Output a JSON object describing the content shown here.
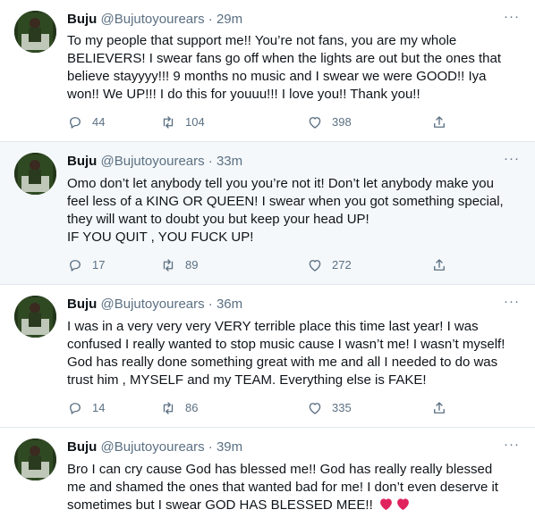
{
  "tweets": [
    {
      "name": "Buju",
      "handle": "@Bujutoyourears",
      "separator": "·",
      "time": "29m",
      "lines": [
        "To my people that support me!! You’re not fans, you are my whole",
        "BELIEVERS! I swear fans go off when the lights are out but the ones that",
        "believe stayyyy!!! 9 months no music and I swear we were GOOD!! Iya",
        "won!! We UP!!! I do this for youuu!!! I love you!! Thank you!!"
      ],
      "replies": "44",
      "retweets": "104",
      "likes": "398"
    },
    {
      "name": "Buju",
      "handle": "@Bujutoyourears",
      "separator": "·",
      "time": "33m",
      "lines": [
        "Omo don’t let anybody tell you you’re not it! Don’t let anybody make you",
        "feel less of a KING OR QUEEN! I swear when you got something special,",
        "they will want to doubt you but keep your head UP!",
        "IF YOU QUIT , YOU FUCK UP!"
      ],
      "replies": "17",
      "retweets": "89",
      "likes": "272"
    },
    {
      "name": "Buju",
      "handle": "@Bujutoyourears",
      "separator": "·",
      "time": "36m",
      "lines": [
        "I was in a very very very VERY terrible place this time last year! I was",
        "confused I really wanted to stop music cause I wasn’t me! I wasn’t myself!",
        "God has really done something great with me and all I needed to do was",
        "trust him , MYSELF and my TEAM. Everything else is FAKE!"
      ],
      "replies": "14",
      "retweets": "86",
      "likes": "335"
    },
    {
      "name": "Buju",
      "handle": "@Bujutoyourears",
      "separator": "·",
      "time": "39m",
      "lines": [
        "Bro I can cry cause God has blessed me!! God has really really blessed",
        "me and shamed the ones that wanted bad for me! I don’t even deserve it",
        "sometimes but I swear GOD HAS BLESSED MEE!!"
      ]
    }
  ],
  "icons": {
    "more": "more-icon",
    "reply": "reply-icon",
    "retweet": "retweet-icon",
    "like": "like-icon",
    "share": "share-icon",
    "emoji": "red-heart-emoji"
  },
  "colors": {
    "text": "#0f1419",
    "secondary": "#5b7083",
    "border": "#e1e8ed",
    "highlight_bg": "#f5f8fa",
    "heart": "#e0245e"
  }
}
